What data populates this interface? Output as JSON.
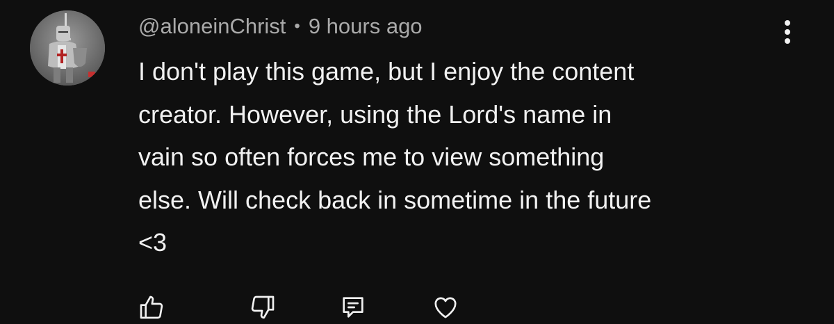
{
  "comment": {
    "author": "@aloneinChrist",
    "separator": "•",
    "timestamp": "9 hours ago",
    "text_lines": [
      "I don't play this game, but I enjoy the content",
      "creator. However, using the Lord's name in",
      "vain so often forces me to view something",
      "else. Will check back in sometime in the future",
      "<3"
    ]
  },
  "actions": {
    "like_icon": "thumbs-up-icon",
    "dislike_icon": "thumbs-down-icon",
    "reply_icon": "reply-comment-icon",
    "heart_icon": "heart-icon"
  },
  "menu_icon": "vertical-ellipsis-icon",
  "colors": {
    "background": "#0f0f0f",
    "text_primary": "#f1f1f1",
    "text_secondary": "#aaaaaa"
  }
}
